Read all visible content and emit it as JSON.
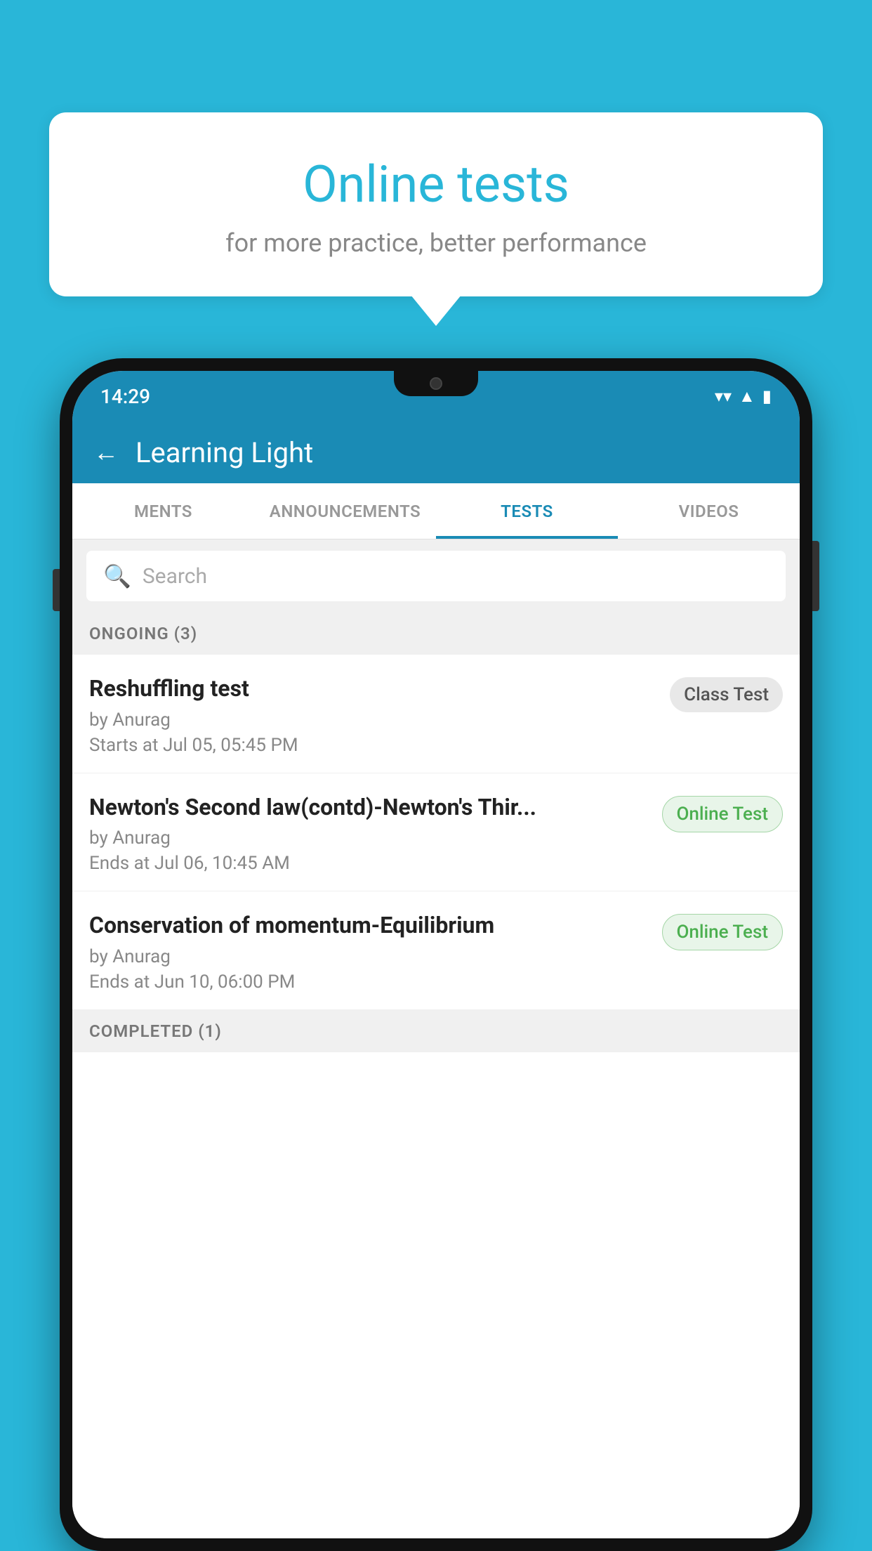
{
  "background_color": "#29b6d8",
  "bubble": {
    "title": "Online tests",
    "subtitle": "for more practice, better performance"
  },
  "phone": {
    "status_bar": {
      "time": "14:29",
      "icons": [
        "wifi",
        "signal",
        "battery"
      ]
    },
    "app_bar": {
      "back_label": "←",
      "title": "Learning Light"
    },
    "tabs": [
      {
        "label": "MENTS",
        "active": false
      },
      {
        "label": "ANNOUNCEMENTS",
        "active": false
      },
      {
        "label": "TESTS",
        "active": true
      },
      {
        "label": "VIDEOS",
        "active": false
      }
    ],
    "search": {
      "placeholder": "Search"
    },
    "sections": [
      {
        "header": "ONGOING (3)",
        "tests": [
          {
            "title": "Reshuffling test",
            "author": "by Anurag",
            "time_label": "Starts at  Jul 05, 05:45 PM",
            "badge": "Class Test",
            "badge_type": "class"
          },
          {
            "title": "Newton's Second law(contd)-Newton's Thir...",
            "author": "by Anurag",
            "time_label": "Ends at  Jul 06, 10:45 AM",
            "badge": "Online Test",
            "badge_type": "online"
          },
          {
            "title": "Conservation of momentum-Equilibrium",
            "author": "by Anurag",
            "time_label": "Ends at  Jun 10, 06:00 PM",
            "badge": "Online Test",
            "badge_type": "online"
          }
        ]
      },
      {
        "header": "COMPLETED (1)"
      }
    ]
  }
}
